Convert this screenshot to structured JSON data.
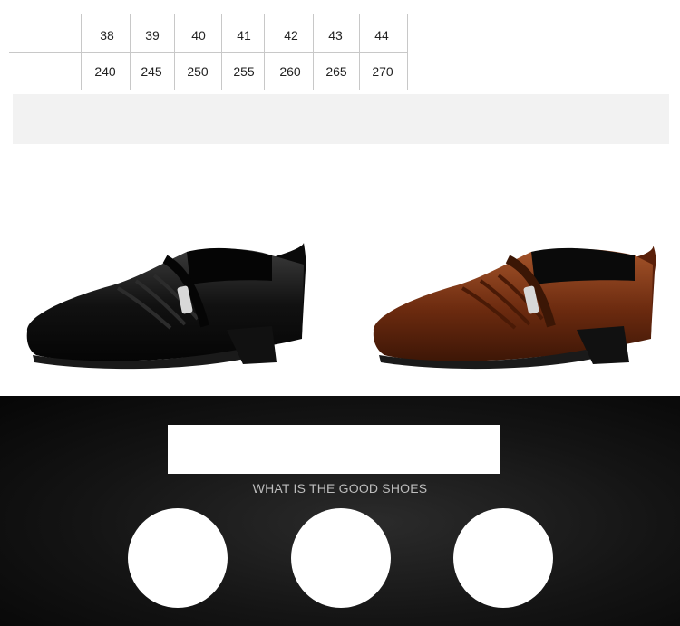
{
  "size_chart": {
    "eu_sizes": [
      "38",
      "39",
      "40",
      "41",
      "42",
      "43",
      "44"
    ],
    "foot_length_mm": [
      "240",
      "245",
      "250",
      "255",
      "260",
      "265",
      "270"
    ]
  },
  "products": {
    "shoes": [
      {
        "name": "black-shoe",
        "color": "#111111"
      },
      {
        "name": "brown-shoe",
        "color": "#7a3412"
      }
    ]
  },
  "banner": {
    "tagline": "WHAT IS THE GOOD SHOES",
    "background_color": "#141414"
  }
}
